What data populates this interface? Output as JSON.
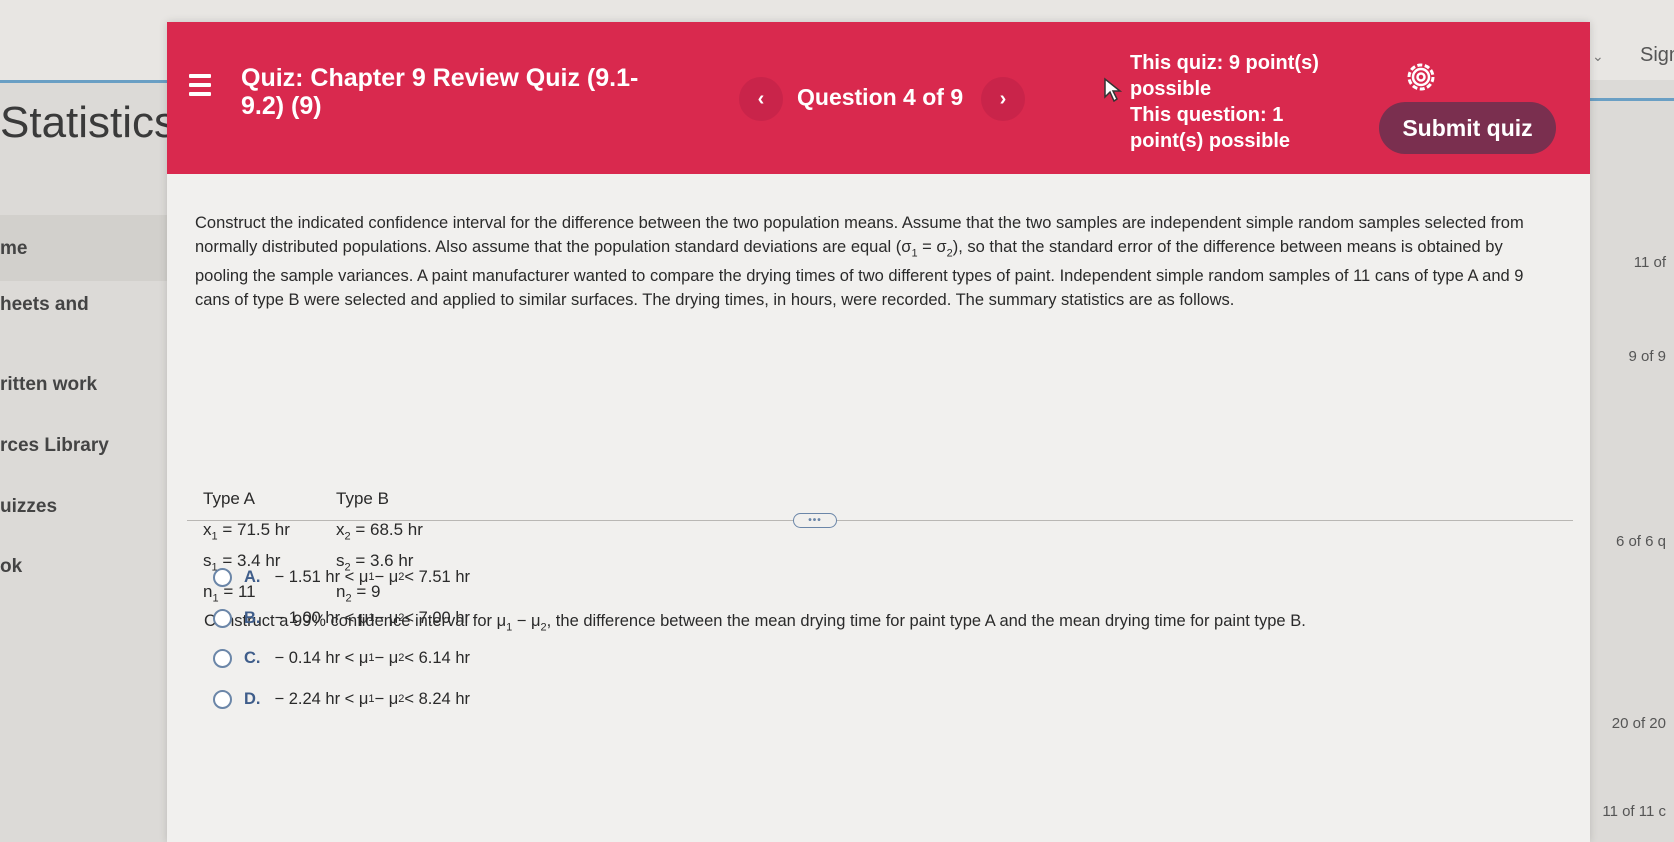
{
  "background": {
    "brand": "Statistics",
    "nav_items": [
      "me",
      "heets and",
      "ritten work",
      "rces Library",
      "uizzes",
      "ok"
    ],
    "right_items": [
      "11 of",
      "9 of 9",
      "6 of 6 q",
      "20 of 20",
      "11 of 11 c"
    ],
    "sign": "Sign"
  },
  "header": {
    "quiz_title": "Quiz: Chapter 9 Review Quiz (9.1-9.2) (9)",
    "prev_label": "‹",
    "next_label": "›",
    "question_counter": "Question 4 of 9",
    "quiz_points": "This quiz: 9 point(s) possible",
    "question_points": "This question: 1 point(s) possible",
    "submit_label": "Submit quiz"
  },
  "question": {
    "text_1": "Construct the indicated confidence interval for the difference between the two population means. Assume that the two samples are independent simple random samples selected from normally distributed populations. Also assume that the population standard deviations are equal (σ",
    "sigma_sub1": "1",
    "text_2": " = σ",
    "sigma_sub2": "2",
    "text_3": "), so that the standard error of the difference between means is obtained by pooling the sample variances. A paint manufacturer wanted to compare the drying times of two different types of paint. Independent simple random samples of 11 cans of type A and 9 cans of type B were selected and applied to similar surfaces. The drying times, in hours, were recorded. The summary statistics are as follows.",
    "type_a": "Type A",
    "type_b": "Type B",
    "x1": "71.5 hr",
    "x2": "68.5 hr",
    "s1": "3.4 hr",
    "s2": "3.6 hr",
    "n1": "11",
    "n2": "9",
    "task_1": "Construct a 99% confidence interval for μ",
    "task_2": " − μ",
    "task_3": ", the difference between the mean drying time for paint type A and the mean drying time for paint type B."
  },
  "choices": [
    {
      "letter": "A.",
      "low": "− 1.51 hr",
      "high": "7.51 hr"
    },
    {
      "letter": "B.",
      "low": "− 1.00 hr",
      "high": "7.00 hr"
    },
    {
      "letter": "C.",
      "low": "− 0.14 hr",
      "high": "6.14 hr"
    },
    {
      "letter": "D.",
      "low": "− 2.24 hr",
      "high": "8.24 hr"
    }
  ]
}
